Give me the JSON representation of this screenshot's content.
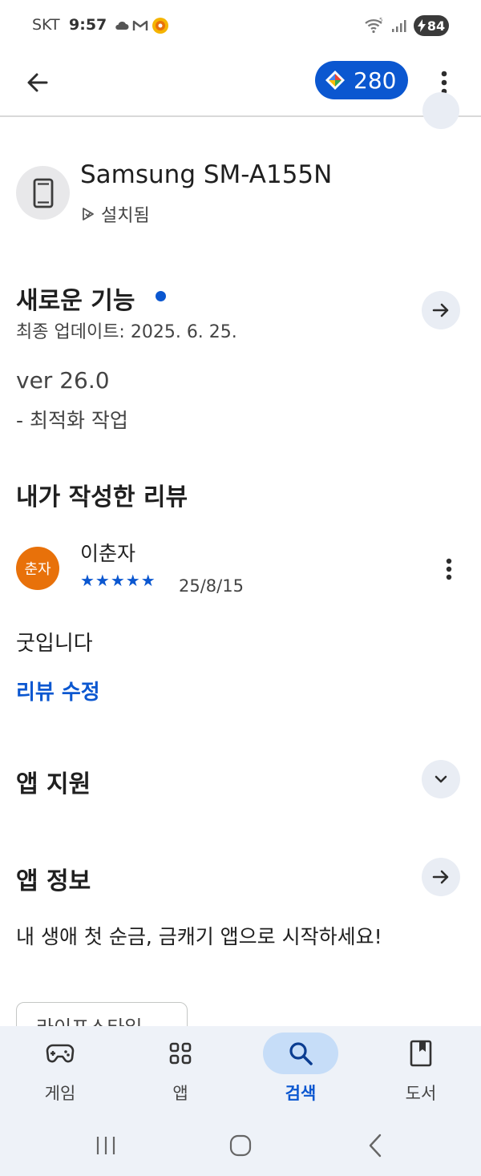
{
  "status_bar": {
    "carrier": "SKT",
    "time": "9:57",
    "battery": "84",
    "notification_icons": [
      "cloud-icon",
      "gmail-icon",
      "app-notification-icon"
    ]
  },
  "app_bar": {
    "points": "280"
  },
  "device": {
    "name": "Samsung SM-A155N",
    "installed_label": "설치됨"
  },
  "whats_new": {
    "title": "새로운 기능",
    "last_updated": "최종 업데이트: 2025. 6. 25.",
    "version": "ver 26.0",
    "note": "- 최적화 작업"
  },
  "my_review": {
    "title": "내가 작성한 리뷰",
    "avatar_text": "춘자",
    "reviewer_name": "이춘자",
    "rating_stars": "★★★★★",
    "rating": 5,
    "date": "25/8/15",
    "body": "굿입니다",
    "edit_label": "리뷰 수정"
  },
  "app_support": {
    "title": "앱 지원"
  },
  "app_info": {
    "title": "앱 정보",
    "description": "내 생애 첫 순금, 금캐기 앱으로 시작하세요!",
    "category_chip": "라이프스타일"
  },
  "bottom_nav": {
    "items": [
      {
        "label": "게임",
        "icon": "gamepad-icon"
      },
      {
        "label": "앱",
        "icon": "apps-grid-icon"
      },
      {
        "label": "검색",
        "icon": "search-icon",
        "active": true
      },
      {
        "label": "도서",
        "icon": "book-icon"
      }
    ]
  },
  "colors": {
    "accent": "#0b57d0",
    "avatar": "#e8710a",
    "nav_background": "#eef2f8",
    "active_pill": "#c6ddf8"
  }
}
